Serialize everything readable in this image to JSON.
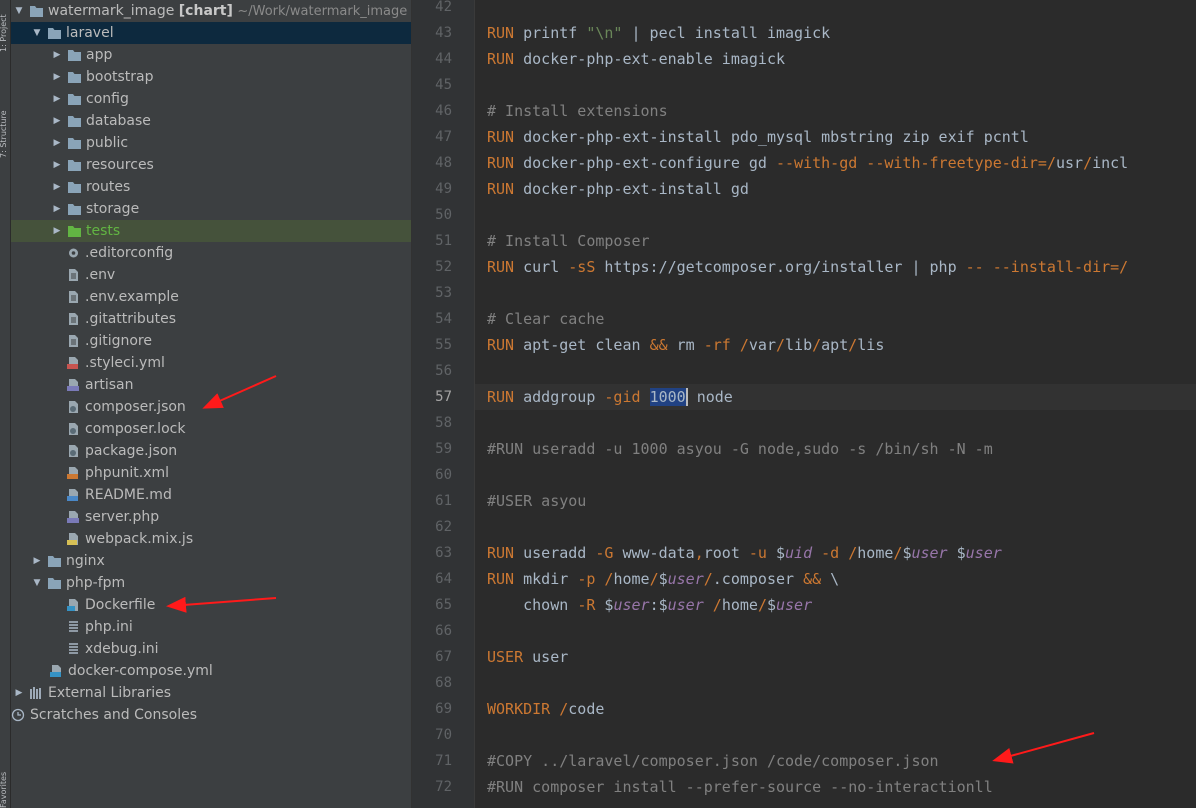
{
  "side_strip": {
    "top_label": "1: Project",
    "mid_label": "7: Structure",
    "bottom_label": "Favorites"
  },
  "tree": {
    "root": {
      "name": "watermark_image",
      "module": "[chart]",
      "path": "~/Work/watermark_image"
    },
    "items": [
      {
        "label": "laravel",
        "type": "folder",
        "depth": 1,
        "expanded": true,
        "selected": true
      },
      {
        "label": "app",
        "type": "folder",
        "depth": 2,
        "expanded": false
      },
      {
        "label": "bootstrap",
        "type": "folder",
        "depth": 2,
        "expanded": false
      },
      {
        "label": "config",
        "type": "folder",
        "depth": 2,
        "expanded": false
      },
      {
        "label": "database",
        "type": "folder",
        "depth": 2,
        "expanded": false
      },
      {
        "label": "public",
        "type": "folder",
        "depth": 2,
        "expanded": false
      },
      {
        "label": "resources",
        "type": "folder",
        "depth": 2,
        "expanded": false
      },
      {
        "label": "routes",
        "type": "folder",
        "depth": 2,
        "expanded": false
      },
      {
        "label": "storage",
        "type": "folder",
        "depth": 2,
        "expanded": false
      },
      {
        "label": "tests",
        "type": "folder-green",
        "depth": 2,
        "expanded": false,
        "highlight": true
      },
      {
        "label": ".editorconfig",
        "type": "gear",
        "depth": 3
      },
      {
        "label": ".env",
        "type": "file",
        "depth": 3
      },
      {
        "label": ".env.example",
        "type": "file",
        "depth": 3
      },
      {
        "label": ".gitattributes",
        "type": "file",
        "depth": 3
      },
      {
        "label": ".gitignore",
        "type": "file",
        "depth": 3
      },
      {
        "label": ".styleci.yml",
        "type": "yml",
        "depth": 3
      },
      {
        "label": "artisan",
        "type": "php",
        "depth": 3
      },
      {
        "label": "composer.json",
        "type": "json",
        "depth": 3
      },
      {
        "label": "composer.lock",
        "type": "json",
        "depth": 3
      },
      {
        "label": "package.json",
        "type": "json",
        "depth": 3
      },
      {
        "label": "phpunit.xml",
        "type": "xml",
        "depth": 3
      },
      {
        "label": "README.md",
        "type": "md",
        "depth": 3
      },
      {
        "label": "server.php",
        "type": "php",
        "depth": 3
      },
      {
        "label": "webpack.mix.js",
        "type": "js",
        "depth": 3
      },
      {
        "label": "nginx",
        "type": "folder",
        "depth": 1,
        "expanded": false
      },
      {
        "label": "php-fpm",
        "type": "folder",
        "depth": 1,
        "expanded": true
      },
      {
        "label": "Dockerfile",
        "type": "docker",
        "depth": 3
      },
      {
        "label": "php.ini",
        "type": "ini",
        "depth": 3
      },
      {
        "label": "xdebug.ini",
        "type": "ini",
        "depth": 3
      },
      {
        "label": "docker-compose.yml",
        "type": "compose",
        "depth": 2
      },
      {
        "label": "External Libraries",
        "type": "libs",
        "depth": 0,
        "expanded": false
      },
      {
        "label": "Scratches and Consoles",
        "type": "scratch",
        "depth": 0
      }
    ]
  },
  "editor": {
    "current_line": 57,
    "lines": [
      {
        "n": 42,
        "parts": []
      },
      {
        "n": 43,
        "parts": [
          [
            "kw",
            "RUN"
          ],
          [
            "",
            "printf "
          ],
          [
            "str",
            "\"\\n\""
          ],
          [
            "",
            " | pecl install imagick"
          ]
        ]
      },
      {
        "n": 44,
        "parts": [
          [
            "kw",
            "RUN"
          ],
          [
            "",
            "docker-php-ext-enable imagick"
          ]
        ]
      },
      {
        "n": 45,
        "parts": []
      },
      {
        "n": 46,
        "parts": [
          [
            "cm",
            "# Install extensions"
          ]
        ]
      },
      {
        "n": 47,
        "parts": [
          [
            "kw",
            "RUN"
          ],
          [
            "",
            "docker-php-ext-install pdo_mysql mbstring zip exif pcntl"
          ]
        ]
      },
      {
        "n": 48,
        "parts": [
          [
            "kw",
            "RUN"
          ],
          [
            "",
            "docker-php-ext-configure gd "
          ],
          [
            "kw",
            "--with-gd --with-freetype-dir="
          ],
          [
            "kw",
            "/"
          ],
          [
            "",
            "usr"
          ],
          [
            "kw",
            "/"
          ],
          [
            "",
            "incl"
          ]
        ]
      },
      {
        "n": 49,
        "parts": [
          [
            "kw",
            "RUN"
          ],
          [
            "",
            "docker-php-ext-install gd"
          ]
        ]
      },
      {
        "n": 50,
        "parts": []
      },
      {
        "n": 51,
        "parts": [
          [
            "cm",
            "# Install Composer"
          ]
        ]
      },
      {
        "n": 52,
        "parts": [
          [
            "kw",
            "RUN"
          ],
          [
            "",
            "curl "
          ],
          [
            "kw",
            "-sS"
          ],
          [
            "",
            " https://getcomposer.org/installer | php "
          ],
          [
            "kw",
            "-- --install-dir=/"
          ]
        ]
      },
      {
        "n": 53,
        "parts": []
      },
      {
        "n": 54,
        "parts": [
          [
            "cm",
            "# Clear cache"
          ]
        ]
      },
      {
        "n": 55,
        "parts": [
          [
            "kw",
            "RUN"
          ],
          [
            "",
            "apt-get clean "
          ],
          [
            "kw",
            "&&"
          ],
          [
            "",
            " rm "
          ],
          [
            "kw",
            "-rf /"
          ],
          [
            "",
            "var"
          ],
          [
            "kw",
            "/"
          ],
          [
            "",
            "lib"
          ],
          [
            "kw",
            "/"
          ],
          [
            "",
            "apt"
          ],
          [
            "kw",
            "/"
          ],
          [
            "",
            "lis"
          ]
        ]
      },
      {
        "n": 56,
        "parts": []
      },
      {
        "n": 57,
        "parts": [
          [
            "kw",
            "RUN"
          ],
          [
            "",
            "addgroup "
          ],
          [
            "kw",
            "-gid "
          ],
          [
            "sel",
            "1000"
          ],
          [
            "",
            " node"
          ]
        ]
      },
      {
        "n": 58,
        "parts": []
      },
      {
        "n": 59,
        "parts": [
          [
            "cm",
            "#RUN useradd -u 1000 asyou -G node,sudo -s /bin/sh -N -m"
          ]
        ]
      },
      {
        "n": 60,
        "parts": []
      },
      {
        "n": 61,
        "parts": [
          [
            "cm",
            "#USER asyou"
          ]
        ]
      },
      {
        "n": 62,
        "parts": []
      },
      {
        "n": 63,
        "parts": [
          [
            "kw",
            "RUN"
          ],
          [
            "",
            "useradd "
          ],
          [
            "kw",
            "-G"
          ],
          [
            "",
            " www-data"
          ],
          [
            "kw",
            ","
          ],
          [
            "",
            "root "
          ],
          [
            "kw",
            "-u "
          ],
          [
            "",
            "$"
          ],
          [
            "var",
            "uid"
          ],
          [
            "kw",
            " -d /"
          ],
          [
            "",
            "home"
          ],
          [
            "kw",
            "/"
          ],
          [
            "",
            "$"
          ],
          [
            "var",
            "user"
          ],
          [
            "",
            " $"
          ],
          [
            "var",
            "user"
          ]
        ]
      },
      {
        "n": 64,
        "parts": [
          [
            "kw",
            "RUN"
          ],
          [
            "",
            "mkdir "
          ],
          [
            "kw",
            "-p /"
          ],
          [
            "",
            "home"
          ],
          [
            "kw",
            "/"
          ],
          [
            "",
            "$"
          ],
          [
            "var",
            "user"
          ],
          [
            "kw",
            "/"
          ],
          [
            ".composer",
            ".composer "
          ],
          [
            "kw",
            "&&"
          ],
          [
            "",
            " \\"
          ]
        ]
      },
      {
        "n": 65,
        "parts": [
          [
            "",
            "    chown "
          ],
          [
            "kw",
            "-R "
          ],
          [
            "",
            "$"
          ],
          [
            "var",
            "user"
          ],
          [
            "",
            ":$"
          ],
          [
            "var",
            "user"
          ],
          [
            "kw",
            " /"
          ],
          [
            "",
            "home"
          ],
          [
            "kw",
            "/"
          ],
          [
            "",
            "$"
          ],
          [
            "var",
            "user"
          ]
        ]
      },
      {
        "n": 66,
        "parts": []
      },
      {
        "n": 67,
        "parts": [
          [
            "kw",
            "USER"
          ],
          [
            "",
            "user"
          ]
        ]
      },
      {
        "n": 68,
        "parts": []
      },
      {
        "n": 69,
        "parts": [
          [
            "kw",
            "WORKDIR"
          ],
          [
            "kw",
            "/"
          ],
          [
            "",
            "code"
          ]
        ]
      },
      {
        "n": 70,
        "parts": []
      },
      {
        "n": 71,
        "parts": [
          [
            "cm",
            "#COPY ../laravel/composer.json /code/composer.json"
          ]
        ]
      },
      {
        "n": 72,
        "parts": [
          [
            "cm",
            "#RUN composer install --prefer-source --no-interactionll"
          ]
        ]
      }
    ]
  },
  "colors": {
    "tree_bg": "#3c3f41",
    "editor_bg": "#2b2b2b",
    "keyword": "#cc7832",
    "string": "#6a8759",
    "comment": "#808080",
    "variable": "#9876aa",
    "selection": "#214283",
    "annotation_arrow": "#ff0000"
  }
}
